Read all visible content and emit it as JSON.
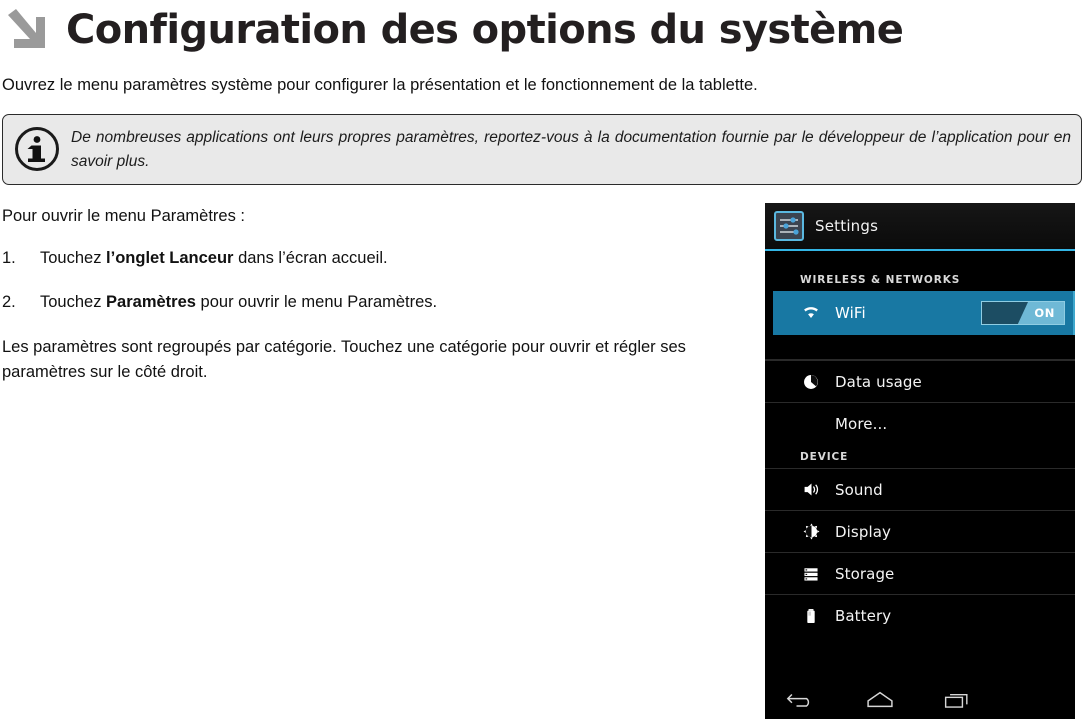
{
  "page": {
    "title": "Configuration des options du système",
    "arrow_icon": "arrow-down-right-icon",
    "intro": "Ouvrez le menu paramètres système pour configurer la présentation et le fonctionnement de la tablette."
  },
  "note": {
    "icon": "info-circle-icon",
    "text": "De nombreuses applications ont leurs propres paramètres, reportez-vous à la documentation fournie par le développeur de l’application pour en savoir plus."
  },
  "instructions": {
    "lead": "Pour ouvrir le menu Paramètres :",
    "steps": [
      {
        "number": "1.",
        "before": "Touchez ",
        "bold": "l’onglet Lanceur",
        "after": " dans l’écran accueil."
      },
      {
        "number": "2.",
        "before": "Touchez ",
        "bold": "Paramètres",
        "after": " pour ouvrir le menu Paramètres."
      }
    ],
    "closing": "Les paramètres sont regroupés par catégorie. Touchez une catégorie pour ouvrir et régler ses paramètres sur le côté droit."
  },
  "android": {
    "actionbar": {
      "icon": "settings-sliders-icon",
      "title": "Settings"
    },
    "accent_color": "#33b5e5",
    "selected_row_color": "#1878a3",
    "sections": [
      {
        "header": "WIRELESS & NETWORKS",
        "items": [
          {
            "label": "WiFi",
            "icon": "wifi-icon",
            "selected": true,
            "toggle": "ON"
          },
          {
            "label": "Data usage",
            "icon": "data-usage-icon",
            "selected": false
          },
          {
            "label": "More...",
            "icon": "",
            "selected": false
          }
        ]
      },
      {
        "header": "DEVICE",
        "items": [
          {
            "label": "Sound",
            "icon": "speaker-icon",
            "selected": false
          },
          {
            "label": "Display",
            "icon": "brightness-icon",
            "selected": false
          },
          {
            "label": "Storage",
            "icon": "storage-icon",
            "selected": false
          },
          {
            "label": "Battery",
            "icon": "battery-icon",
            "selected": false
          }
        ]
      }
    ],
    "navbar": [
      {
        "name": "back-icon"
      },
      {
        "name": "home-icon"
      },
      {
        "name": "recent-apps-icon"
      }
    ]
  }
}
